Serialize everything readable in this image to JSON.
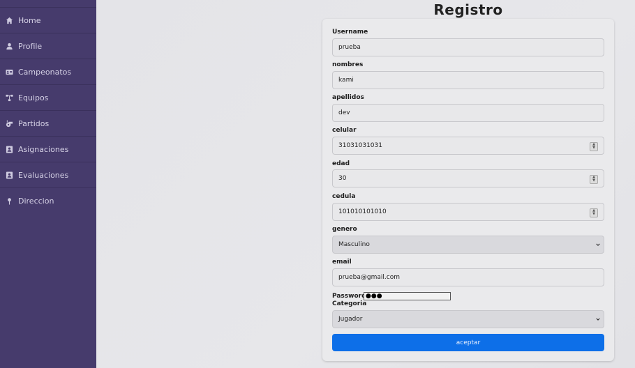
{
  "sidebar": {
    "items": [
      {
        "label": "Home",
        "icon": "home-icon"
      },
      {
        "label": "Profile",
        "icon": "user-icon"
      },
      {
        "label": "Campeonatos",
        "icon": "id-card-icon"
      },
      {
        "label": "Equipos",
        "icon": "network-icon"
      },
      {
        "label": "Partidos",
        "icon": "whistle-icon"
      },
      {
        "label": "Asignaciones",
        "icon": "contact-icon"
      },
      {
        "label": "Evaluaciones",
        "icon": "contact-icon"
      },
      {
        "label": "Direccion",
        "icon": "map-pin-icon"
      }
    ]
  },
  "form": {
    "title": "Registro",
    "fields": {
      "username": {
        "label": "Username",
        "value": "prueba"
      },
      "nombres": {
        "label": "nombres",
        "value": "kami"
      },
      "apellidos": {
        "label": "apellidos",
        "value": "dev"
      },
      "celular": {
        "label": "celular",
        "value": "31031031031"
      },
      "edad": {
        "label": "edad",
        "value": "30"
      },
      "cedula": {
        "label": "cedula",
        "value": "101010101010"
      },
      "genero": {
        "label": "genero",
        "value": "Masculino"
      },
      "email": {
        "label": "email",
        "value": "prueba@gmail.com"
      },
      "password": {
        "label": "Password",
        "value": "●●●"
      },
      "categoria": {
        "label": "Categoria",
        "value": "Jugador"
      }
    },
    "submit_label": "aceptar"
  },
  "colors": {
    "sidebar_bg": "#463b6c",
    "button_bg": "#0d6fe8"
  }
}
